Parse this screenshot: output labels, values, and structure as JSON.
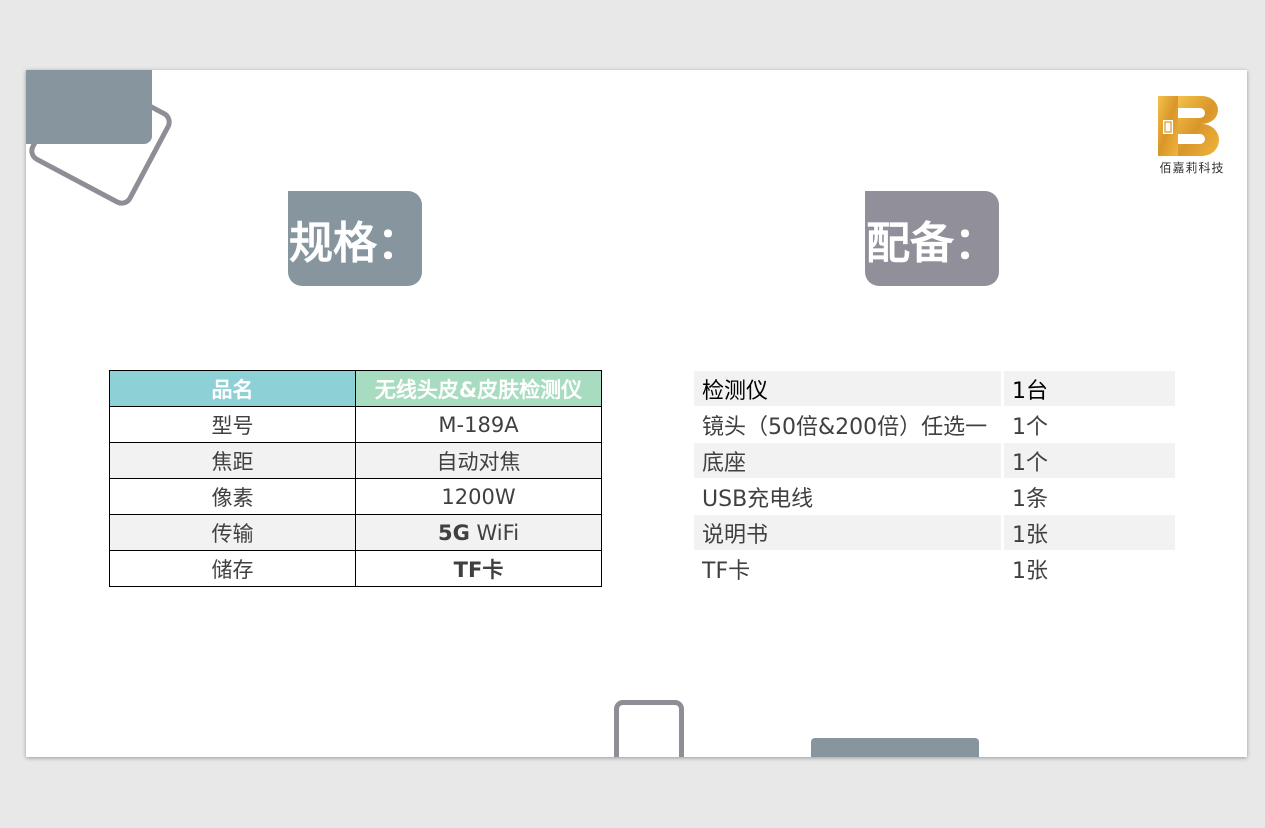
{
  "logo": {
    "text": "佰嘉莉科技",
    "icon": "bjl-gold-logo"
  },
  "colors": {
    "spec_title_bg": "#86959e",
    "acc_title_bg": "#918f99",
    "spec_head_left": "#8dd1d6",
    "spec_head_right": "#a8dcc0",
    "logo_gold": "#e2a83a"
  },
  "spec": {
    "title": "规格：",
    "header": [
      "品名",
      "无线头皮&皮肤检测仪"
    ],
    "rows": [
      [
        "型号",
        "M-189A"
      ],
      [
        "焦距",
        "自动对焦"
      ],
      [
        "像素",
        "1200W"
      ],
      [
        "传输",
        "5G",
        " WiFi"
      ],
      [
        "储存",
        "TF卡"
      ]
    ]
  },
  "accessories": {
    "title": "配备：",
    "rows": [
      [
        "检测仪",
        "1台"
      ],
      [
        "镜头（50倍&200倍）任选一",
        "1个"
      ],
      [
        "底座",
        "1个"
      ],
      [
        "USB充电线",
        "1条"
      ],
      [
        "说明书",
        "1张"
      ],
      [
        "TF卡",
        "1张"
      ]
    ]
  }
}
